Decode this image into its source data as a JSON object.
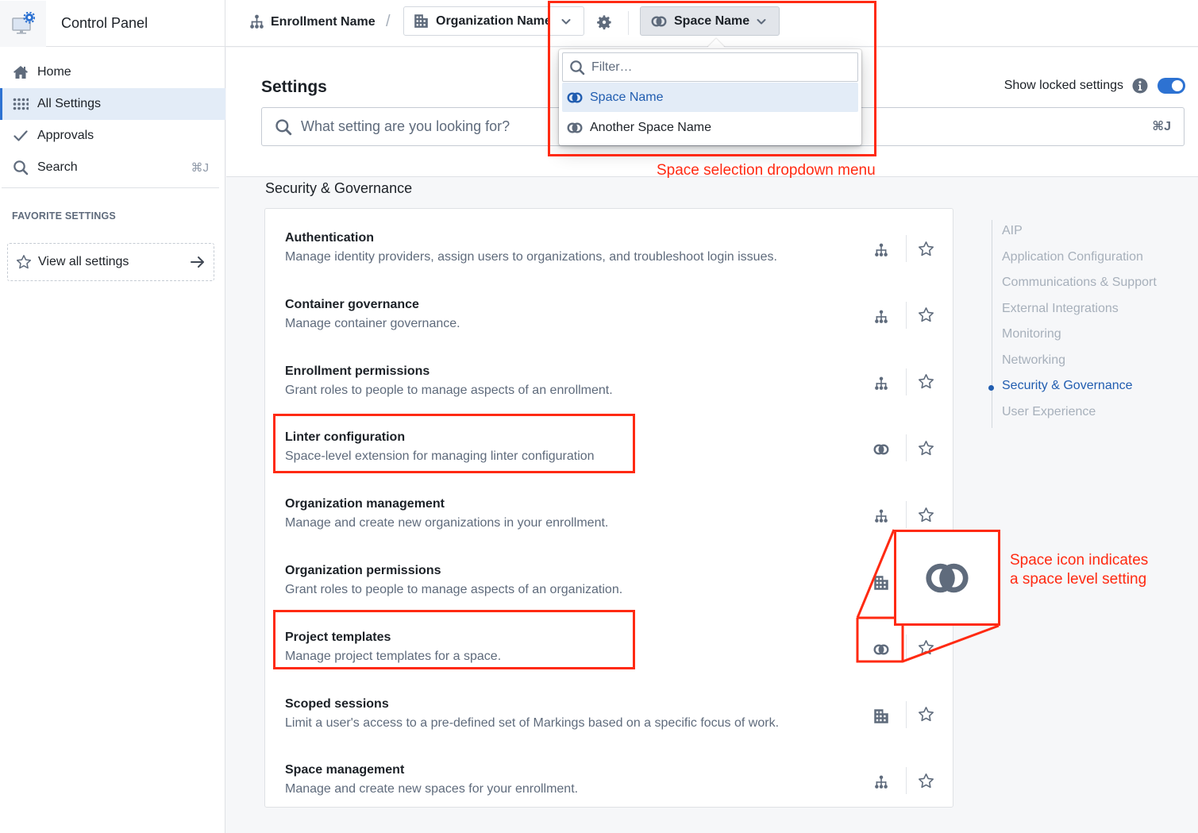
{
  "app": {
    "title": "Control Panel",
    "logo_icon": "monitor-gear-icon"
  },
  "topbar": {
    "enrollment": {
      "icon": "hierarchy-icon",
      "label": "Enrollment Name"
    },
    "separator": "/",
    "organization": {
      "icon": "building-icon",
      "label": "Organization Name",
      "chevron": "chevron-down-icon"
    },
    "settings_icon": "gear-icon",
    "space": {
      "icon": "space-icon",
      "label": "Space Name",
      "chevron": "chevron-down-icon"
    }
  },
  "sidebar": {
    "items": [
      {
        "icon": "home-icon",
        "label": "Home",
        "active": false
      },
      {
        "icon": "grid-dots-icon",
        "label": "All Settings",
        "active": true
      },
      {
        "icon": "check-icon",
        "label": "Approvals",
        "active": false
      },
      {
        "icon": "search-icon",
        "label": "Search",
        "active": false,
        "shortcut": "⌘J"
      }
    ],
    "favorites_title": "FAVORITE SETTINGS",
    "view_all": {
      "icon": "star-icon",
      "label": "View all settings",
      "arrow": "arrow-right-icon"
    }
  },
  "header": {
    "title": "Settings",
    "show_locked": {
      "label": "Show locked settings",
      "info_icon": "info-icon",
      "enabled": true
    },
    "search": {
      "placeholder": "What setting are you looking for?",
      "value": "",
      "shortcut": "⌘J"
    }
  },
  "dropdown": {
    "filter_placeholder": "Filter…",
    "options": [
      {
        "label": "Space Name",
        "icon": "space-icon",
        "selected": true
      },
      {
        "label": "Another Space Name",
        "icon": "space-icon",
        "selected": false
      }
    ]
  },
  "section": {
    "title": "Security & Governance",
    "settings": [
      {
        "name": "Authentication",
        "description": "Manage identity providers, assign users to organizations, and troubleshoot login issues.",
        "scope": "enrollment"
      },
      {
        "name": "Container governance",
        "description": "Manage container governance.",
        "scope": "enrollment"
      },
      {
        "name": "Enrollment permissions",
        "description": "Grant roles to people to manage aspects of an enrollment.",
        "scope": "enrollment"
      },
      {
        "name": "Linter configuration",
        "description": "Space-level extension for managing linter configuration",
        "scope": "space"
      },
      {
        "name": "Organization management",
        "description": "Manage and create new organizations in your enrollment.",
        "scope": "enrollment"
      },
      {
        "name": "Organization permissions",
        "description": "Grant roles to people to manage aspects of an organization.",
        "scope": "organization"
      },
      {
        "name": "Project templates",
        "description": "Manage project templates for a space.",
        "scope": "space"
      },
      {
        "name": "Scoped sessions",
        "description": "Limit a user's access to a pre-defined set of Markings based on a specific focus of work.",
        "scope": "organization"
      },
      {
        "name": "Space management",
        "description": "Manage and create new spaces for your enrollment.",
        "scope": "enrollment"
      }
    ]
  },
  "toc": {
    "items": [
      {
        "label": "AIP",
        "active": false
      },
      {
        "label": "Application Configuration",
        "active": false
      },
      {
        "label": "Communications & Support",
        "active": false
      },
      {
        "label": "External Integrations",
        "active": false
      },
      {
        "label": "Monitoring",
        "active": false
      },
      {
        "label": "Networking",
        "active": false
      },
      {
        "label": "Security & Governance",
        "active": true
      },
      {
        "label": "User Experience",
        "active": false
      }
    ]
  },
  "annotations": {
    "dropdown_label": "Space selection dropdown menu",
    "space_icon_label_line1": "Space icon indicates",
    "space_icon_label_line2": "a space level setting"
  },
  "colors": {
    "accent": "#2d72d2",
    "accent_text": "#215db0",
    "annotation": "#ff2a12",
    "icon_gray": "#5f6b7c"
  }
}
